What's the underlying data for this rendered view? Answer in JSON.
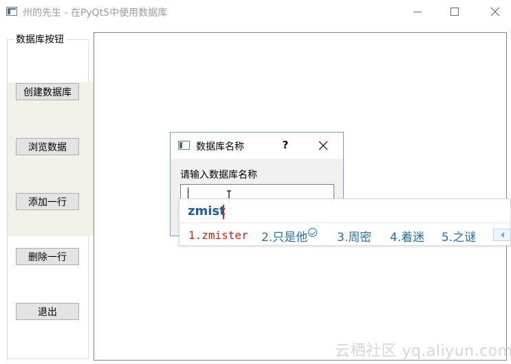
{
  "window": {
    "title": "州的先生 - 在PyQt5中使用数据库",
    "minimize_icon": "minimize-icon",
    "maximize_icon": "maximize-icon",
    "close_icon": "close-icon"
  },
  "groupbox": {
    "title": "数据库按钮",
    "buttons": [
      "创建数据库",
      "浏览数据",
      "添加一行",
      "删除一行",
      "退出"
    ]
  },
  "dialog": {
    "title": "数据库名称",
    "help_label": "?",
    "prompt": "请输入数据库名称",
    "input_value": "",
    "close_icon": "close-icon"
  },
  "ime": {
    "composition": "zmist",
    "candidates": [
      "1.zmister",
      "2.只是他",
      "3.周密",
      "4.着迷",
      "5.之谜"
    ],
    "colors": {
      "first": "#d81e06",
      "others": "#1f6fbf",
      "composition": "#1b5fa8"
    }
  },
  "watermark": "云栖社区 yq.aliyun.com"
}
